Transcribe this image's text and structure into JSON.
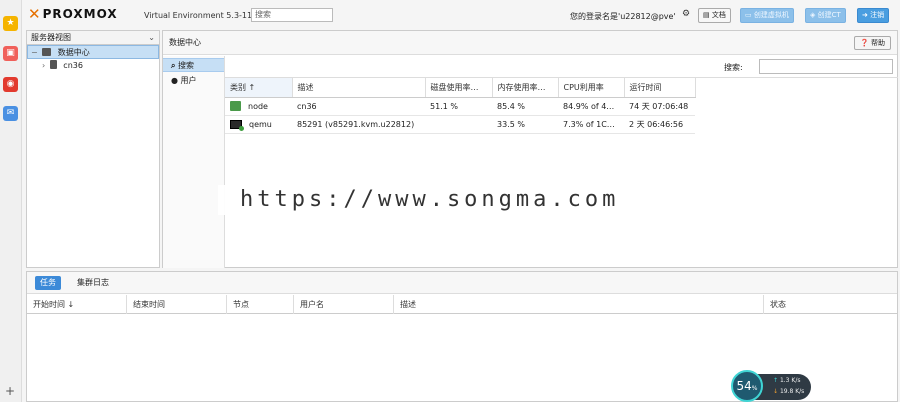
{
  "header": {
    "brand": "PROXMOX",
    "version": "Virtual Environment 5.3-11",
    "search_placeholder": "搜索",
    "login_text": "您的登录名是'u22812@pve'",
    "docs_label": "文档",
    "create_vm_label": "创建虚拟机",
    "create_ct_label": "创建CT",
    "logout_label": "注销"
  },
  "tree": {
    "view_label": "服务器视图",
    "root": "数据中心",
    "node": "cn36"
  },
  "main": {
    "breadcrumb": "数据中心",
    "help_label": "帮助",
    "nav": [
      {
        "label": "搜索",
        "icon": "search-icon"
      },
      {
        "label": "用户",
        "icon": "user-icon"
      }
    ],
    "search_label": "搜索:",
    "columns": [
      "类别 ↑",
      "描述",
      "磁盘使用率…",
      "内存使用率…",
      "CPU利用率",
      "运行时间"
    ],
    "rows": [
      {
        "type": "node",
        "desc": "cn36",
        "disk": "51.1 %",
        "mem": "85.4 %",
        "cpu": "84.9% of 4…",
        "uptime": "74 天 07:06:48"
      },
      {
        "type": "qemu",
        "desc": "85291 (v85291.kvm.u22812)",
        "disk": "",
        "mem": "33.5 %",
        "cpu": "7.3% of 1C…",
        "uptime": "2 天 06:46:56"
      }
    ]
  },
  "bottom": {
    "tabs": [
      "任务",
      "集群日志"
    ],
    "columns": [
      "开始时间 ↓",
      "结束时间",
      "节点",
      "用户名",
      "描述",
      "状态"
    ]
  },
  "watermark": "https://www.songma.com",
  "speed": {
    "percent": "54",
    "unit": "%",
    "up": "1.3 K/s",
    "down": "19.8 K/s"
  },
  "colors": {
    "accent": "#3c8ad8",
    "brand": "#e57000",
    "selection": "#c6dff5"
  }
}
